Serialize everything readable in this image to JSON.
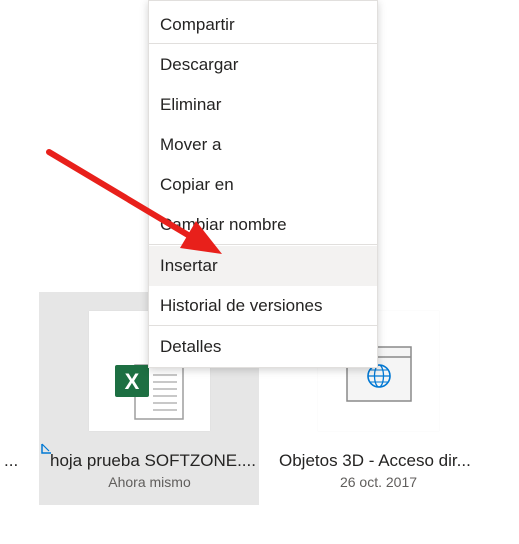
{
  "context_menu": {
    "items": [
      {
        "label": "Compartir"
      },
      {
        "label": "Descargar"
      },
      {
        "label": "Eliminar"
      },
      {
        "label": "Mover a"
      },
      {
        "label": "Copiar en"
      },
      {
        "label": "Cambiar nombre"
      },
      {
        "label": "Insertar"
      },
      {
        "label": "Historial de versiones"
      },
      {
        "label": "Detalles"
      }
    ]
  },
  "files": [
    {
      "name": "...",
      "icon": "truncated"
    },
    {
      "name": "hoja prueba SOFTZONE....",
      "date": "Ahora mismo",
      "icon": "excel-icon",
      "selected": true
    },
    {
      "name": "Objetos 3D - Acceso dir...",
      "date": "26 oct. 2017",
      "icon": "web-shortcut-icon"
    }
  ],
  "colors": {
    "excel_green": "#1d6f42",
    "arrow_red": "#e8201b",
    "selection_bg": "#e6e6e6",
    "link_blue": "#0078d4"
  }
}
